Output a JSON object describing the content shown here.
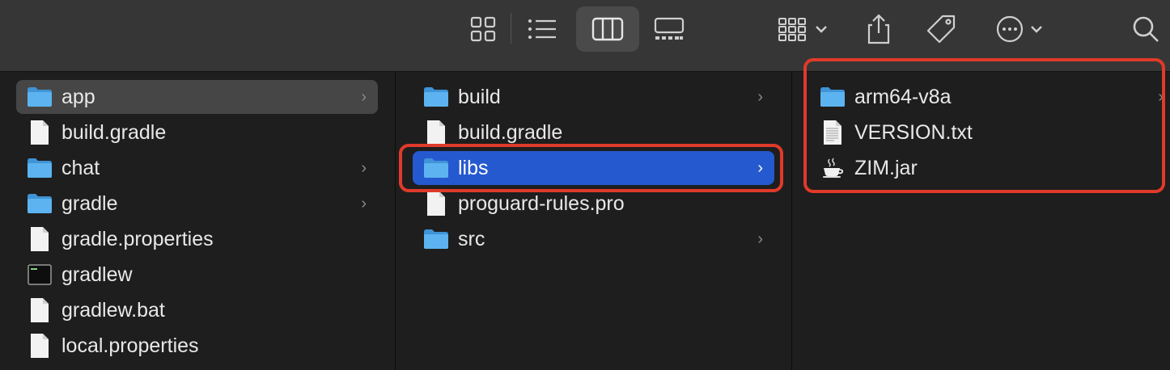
{
  "toolbar": {
    "buttons": [
      "icon-view-grid",
      "list-view",
      "column-view",
      "gallery-view",
      "group-by",
      "share",
      "tag",
      "more-actions",
      "search"
    ],
    "active_view": "column-view"
  },
  "columns": [
    {
      "items": [
        {
          "name": "app",
          "type": "folder",
          "has_children": true,
          "selected": "inactive"
        },
        {
          "name": "build.gradle",
          "type": "file"
        },
        {
          "name": "chat",
          "type": "folder",
          "has_children": true
        },
        {
          "name": "gradle",
          "type": "folder",
          "has_children": true
        },
        {
          "name": "gradle.properties",
          "type": "file"
        },
        {
          "name": "gradlew",
          "type": "executable"
        },
        {
          "name": "gradlew.bat",
          "type": "file"
        },
        {
          "name": "local.properties",
          "type": "file"
        }
      ]
    },
    {
      "items": [
        {
          "name": "build",
          "type": "folder",
          "has_children": true
        },
        {
          "name": "build.gradle",
          "type": "file"
        },
        {
          "name": "libs",
          "type": "folder",
          "has_children": true,
          "selected": "active"
        },
        {
          "name": "proguard-rules.pro",
          "type": "file"
        },
        {
          "name": "src",
          "type": "folder",
          "has_children": true
        }
      ]
    },
    {
      "items": [
        {
          "name": "arm64-v8a",
          "type": "folder",
          "has_children": true
        },
        {
          "name": "VERSION.txt",
          "type": "text-file"
        },
        {
          "name": "ZIM.jar",
          "type": "jar"
        }
      ]
    }
  ],
  "colors": {
    "toolbar_bg": "#363636",
    "pane_bg": "#1e1e1e",
    "selection_blue": "#2559d0",
    "selection_grey": "#464646",
    "folder_blue": "#4fa8e8",
    "highlight_red": "#e03a2a"
  }
}
